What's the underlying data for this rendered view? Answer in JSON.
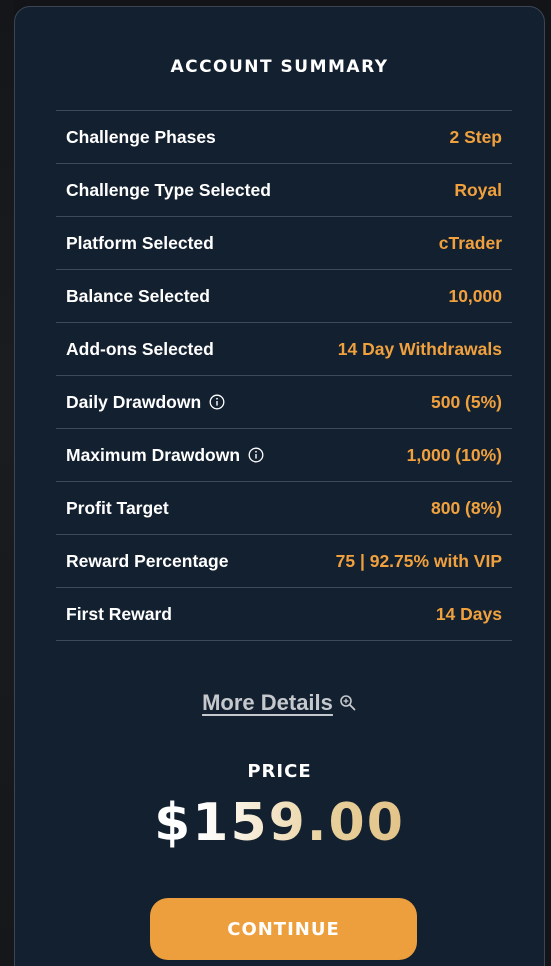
{
  "summary": {
    "title": "ACCOUNT SUMMARY",
    "rows": [
      {
        "label": "Challenge Phases",
        "value": "2 Step",
        "info": false
      },
      {
        "label": "Challenge Type Selected",
        "value": "Royal",
        "info": false
      },
      {
        "label": "Platform Selected",
        "value": "cTrader",
        "info": false
      },
      {
        "label": "Balance Selected",
        "value": "10,000",
        "info": false
      },
      {
        "label": "Add-ons Selected",
        "value": "14 Day Withdrawals",
        "info": false
      },
      {
        "label": "Daily Drawdown",
        "value": "500 (5%)",
        "info": true
      },
      {
        "label": "Maximum Drawdown",
        "value": "1,000 (10%)",
        "info": true
      },
      {
        "label": "Profit Target",
        "value": "800 (8%)",
        "info": false
      },
      {
        "label": "Reward Percentage",
        "value": "75 | 92.75% with VIP",
        "info": false
      },
      {
        "label": "First Reward",
        "value": "14 Days",
        "info": false
      }
    ]
  },
  "more_details": {
    "label": "More Details",
    "icon": "zoom-in-icon"
  },
  "price": {
    "label": "PRICE",
    "value": "$159.00"
  },
  "continue_button": {
    "label": "CONTINUE"
  },
  "colors": {
    "card_background": "#13202f",
    "accent": "#ee9f3d",
    "value_text": "#f0a13e",
    "label_text": "#ffffff",
    "divider": "#3e4a59"
  }
}
